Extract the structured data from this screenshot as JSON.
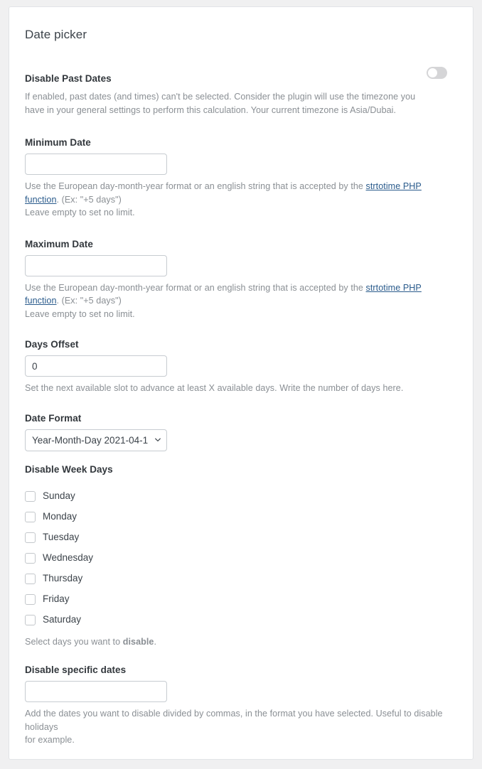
{
  "panel": {
    "title": "Date picker"
  },
  "colors": {
    "page_background": "#f0f0f1",
    "card_background": "#ffffff",
    "card_border": "#e2e4e7",
    "label_text": "#32373c",
    "help_text": "#8a8f94",
    "link": "#2a5b8c",
    "input_border": "#c7ccd1",
    "toggle_off_track": "#d5d5d7",
    "toggle_knob": "#ffffff"
  },
  "disable_past_dates": {
    "label": "Disable Past Dates",
    "help_line1": "If enabled, past dates (and times) can't be selected. Consider the plugin will use the timezone you",
    "help_line2": "have in your general settings to perform this calculation. Your current timezone is Asia/Dubai.",
    "toggle_state": "off"
  },
  "minimum_date": {
    "label": "Minimum Date",
    "value": "",
    "placeholder": "",
    "help_prefix": "Use the European day-month-year format or an english string that is accepted by the ",
    "help_link": "strtotime PHP function",
    "help_suffix": ". (Ex: \"+5 days\")",
    "help_second_line": "Leave empty to set no limit."
  },
  "maximum_date": {
    "label": "Maximum Date",
    "value": "",
    "placeholder": "",
    "help_prefix": "Use the European day-month-year format or an english string that is accepted by the ",
    "help_link": "strtotime PHP function",
    "help_suffix": ". (Ex: \"+5 days\")",
    "help_second_line": "Leave empty to set no limit."
  },
  "days_offset": {
    "label": "Days Offset",
    "value": "0",
    "placeholder": "",
    "help": "Set the next available slot to advance at least X available days. Write the number of days here."
  },
  "date_format": {
    "label": "Date Format",
    "selected": "Year-Month-Day 2021-04-1",
    "options": [
      "Year-Month-Day 2021-04-1"
    ]
  },
  "disable_week_days": {
    "label": "Disable Week Days",
    "days": [
      {
        "label": "Sunday",
        "checked": false
      },
      {
        "label": "Monday",
        "checked": false
      },
      {
        "label": "Tuesday",
        "checked": false
      },
      {
        "label": "Wednesday",
        "checked": false
      },
      {
        "label": "Thursday",
        "checked": false
      },
      {
        "label": "Friday",
        "checked": false
      },
      {
        "label": "Saturday",
        "checked": false
      }
    ],
    "help_prefix": "Select days you want to ",
    "help_bold": "disable",
    "help_suffix": "."
  },
  "disable_specific_dates": {
    "label": "Disable specific dates",
    "value": "",
    "placeholder": "",
    "help_line1": "Add the dates you want to disable divided by commas, in the format you have selected. Useful to disable holidays",
    "help_line2": "for example."
  }
}
